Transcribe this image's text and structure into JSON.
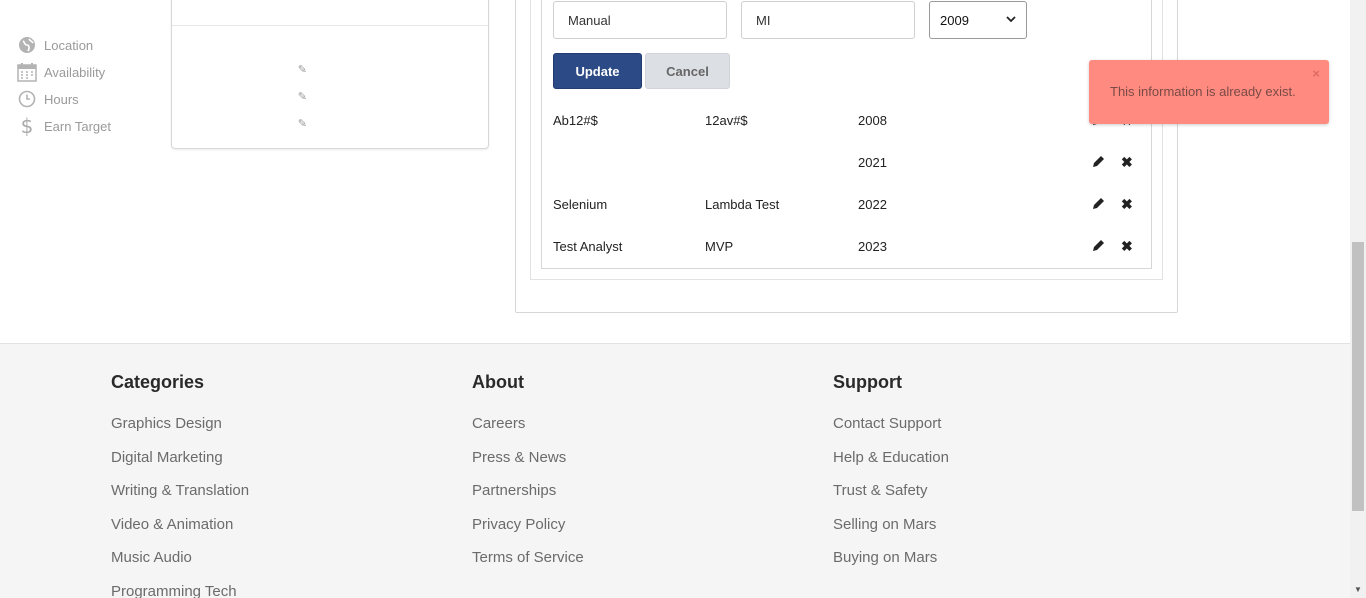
{
  "profile": {
    "items": [
      {
        "label": "Location",
        "icon": "globe-icon",
        "editable": false
      },
      {
        "label": "Availability",
        "icon": "calendar-icon",
        "editable": true
      },
      {
        "label": "Hours",
        "icon": "clock-icon",
        "editable": true
      },
      {
        "label": "Earn Target",
        "icon": "dollar-icon",
        "editable": true
      }
    ]
  },
  "form": {
    "field1_value": "Manual",
    "field2_value": "MI",
    "year_value": "2009",
    "update_label": "Update",
    "cancel_label": "Cancel"
  },
  "rows": [
    {
      "col1": "Ab12#$",
      "col2": "12av#$",
      "col3": "2008"
    },
    {
      "col1": "",
      "col2": "",
      "col3": "2021"
    },
    {
      "col1": "Selenium",
      "col2": "Lambda Test",
      "col3": "2022"
    },
    {
      "col1": "Test Analyst",
      "col2": "MVP",
      "col3": "2023"
    }
  ],
  "toast": {
    "message": "This information is already exist.",
    "close": "×",
    "color": "#ff8a80"
  },
  "footer": {
    "categories": {
      "title": "Categories",
      "links": [
        "Graphics Design",
        "Digital Marketing",
        "Writing & Translation",
        "Video & Animation",
        "Music Audio",
        "Programming Tech"
      ]
    },
    "about": {
      "title": "About",
      "links": [
        "Careers",
        "Press & News",
        "Partnerships",
        "Privacy Policy",
        "Terms of Service"
      ]
    },
    "support": {
      "title": "Support",
      "links": [
        "Contact Support",
        "Help & Education",
        "Trust & Safety",
        "Selling on Mars",
        "Buying on Mars"
      ]
    }
  },
  "colors": {
    "primary_button": "#2c4a86",
    "cancel_button": "#dcdfe3"
  }
}
